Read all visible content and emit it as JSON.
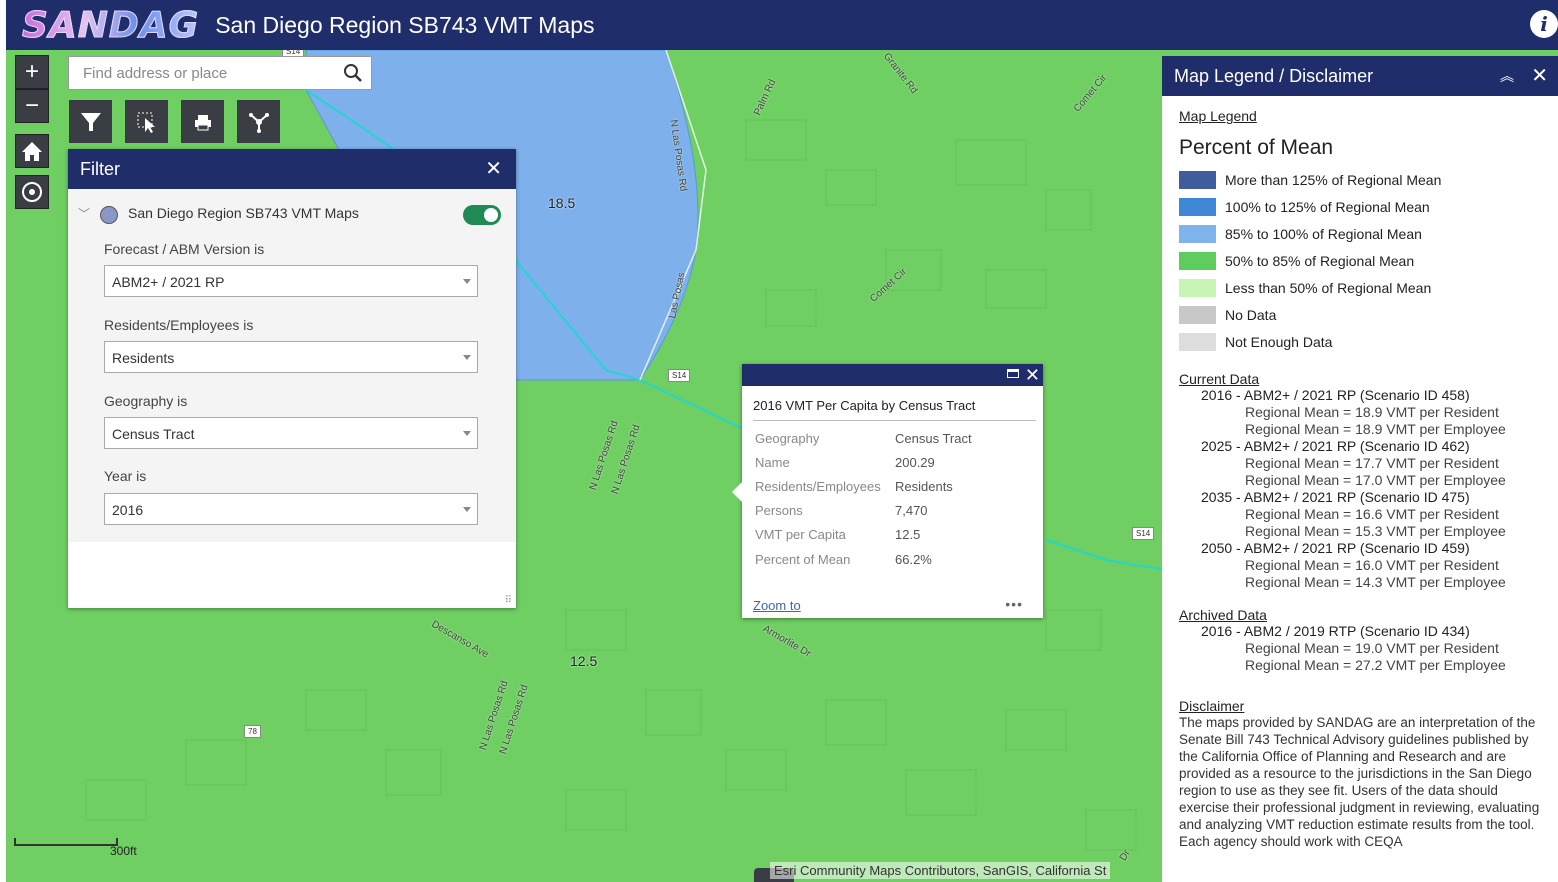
{
  "header": {
    "logo_text": "SANDAG",
    "title": "San Diego Region SB743 VMT Maps",
    "info_icon": "info-icon"
  },
  "map": {
    "values": {
      "a": "18.5",
      "b": "12.5"
    },
    "road_labels": {
      "granite": "Granite Rd",
      "palm": "Palm Rd",
      "comet_cir_top": "Comet Cir",
      "comet_cir": "Comet Cir",
      "n_las_posas_top": "N Las Posas Rd",
      "las_posas": "Las Posas",
      "n_las_posas_1": "N Las Posas Rd",
      "n_las_posas_2": "N Las Posas Rd",
      "n_las_posas_3": "N Las Posas Rd",
      "n_las_posas_4": "N Las Posas Rd",
      "descanso": "Descanso Ave",
      "armorlite": "Armorlite Dr",
      "dr": "Dr"
    },
    "shields": {
      "s1": "S14",
      "s2": "S14",
      "s3": "78",
      "s4": "S14"
    },
    "scale_label": "300ft",
    "attribution": "Esri Community Maps Contributors, SanGIS, California St"
  },
  "controls": {
    "zoom_in": "+",
    "zoom_out": "−",
    "search_placeholder": "Find address or place"
  },
  "filter": {
    "title": "Filter",
    "layer_name": "San Diego Region SB743 VMT Maps",
    "layer_enabled": true,
    "fields": [
      {
        "label": "Forecast / ABM Version is",
        "value": "ABM2+ / 2021 RP"
      },
      {
        "label": "Residents/Employees is",
        "value": "Residents"
      },
      {
        "label": "Geography is",
        "value": "Census Tract"
      },
      {
        "label": "Year is",
        "value": "2016"
      }
    ]
  },
  "popup": {
    "title": "2016 VMT Per Capita by Census Tract",
    "rows": [
      {
        "key": "Geography",
        "value": "Census Tract"
      },
      {
        "key": "Name",
        "value": "200.29"
      },
      {
        "key": "Residents/Employees",
        "value": "Residents"
      },
      {
        "key": "Persons",
        "value": "7,470"
      },
      {
        "key": "VMT per Capita",
        "value": "12.5"
      },
      {
        "key": "Percent of Mean",
        "value": "66.2%"
      }
    ],
    "zoom_label": "Zoom to",
    "more_label": "•••"
  },
  "legend": {
    "title": "Map Legend / Disclaimer",
    "map_legend_heading": "Map Legend",
    "pom_title": "Percent of Mean",
    "items": [
      {
        "label": "More than 125% of Regional Mean",
        "color": "#3f5d9c"
      },
      {
        "label": "100% to 125% of Regional Mean",
        "color": "#3f86d6"
      },
      {
        "label": "85% to 100% of Regional Mean",
        "color": "#7fb3ec"
      },
      {
        "label": "50% to 85% of Regional Mean",
        "color": "#5fcd5e"
      },
      {
        "label": "Less than 50% of Regional Mean",
        "color": "#c8f5b4"
      },
      {
        "label": "No Data",
        "color": "#c8c8c8"
      },
      {
        "label": "Not Enough Data",
        "color": "#dddddd"
      }
    ],
    "current_heading": "Current Data",
    "current": [
      {
        "scenario": "2016 - ABM2+ / 2021 RP (Scenario ID 458)",
        "res": "Regional Mean = 18.9 VMT per Resident",
        "emp": "Regional Mean = 18.9 VMT per Employee"
      },
      {
        "scenario": "2025 - ABM2+ / 2021 RP (Scenario ID 462)",
        "res": "Regional Mean = 17.7 VMT per Resident",
        "emp": "Regional Mean = 17.0 VMT per Employee"
      },
      {
        "scenario": "2035 - ABM2+ / 2021 RP (Scenario ID 475)",
        "res": "Regional Mean = 16.6 VMT per Resident",
        "emp": "Regional Mean = 15.3 VMT per Employee"
      },
      {
        "scenario": "2050 - ABM2+ / 2021 RP (Scenario ID 459)",
        "res": "Regional Mean = 16.0 VMT per Resident",
        "emp": "Regional Mean = 14.3 VMT per Employee"
      }
    ],
    "archived_heading": "Archived Data",
    "archived": [
      {
        "scenario": "2016 - ABM2 / 2019 RTP (Scenario ID 434)",
        "res": "Regional Mean = 19.0 VMT per Resident",
        "emp": "Regional Mean = 27.2 VMT per Employee"
      }
    ],
    "disclaimer_heading": "Disclaimer",
    "disclaimer_text": "The maps provided by SANDAG are an interpretation of the Senate Bill 743 Technical Advisory guidelines published by the California Office of Planning and Research and are provided as a resource to the jurisdictions in the San Diego region to use as they see fit. Users of the data should exercise their professional judgment in reviewing, evaluating and analyzing VMT reduction estimate results from the tool. Each agency should work with CEQA"
  }
}
